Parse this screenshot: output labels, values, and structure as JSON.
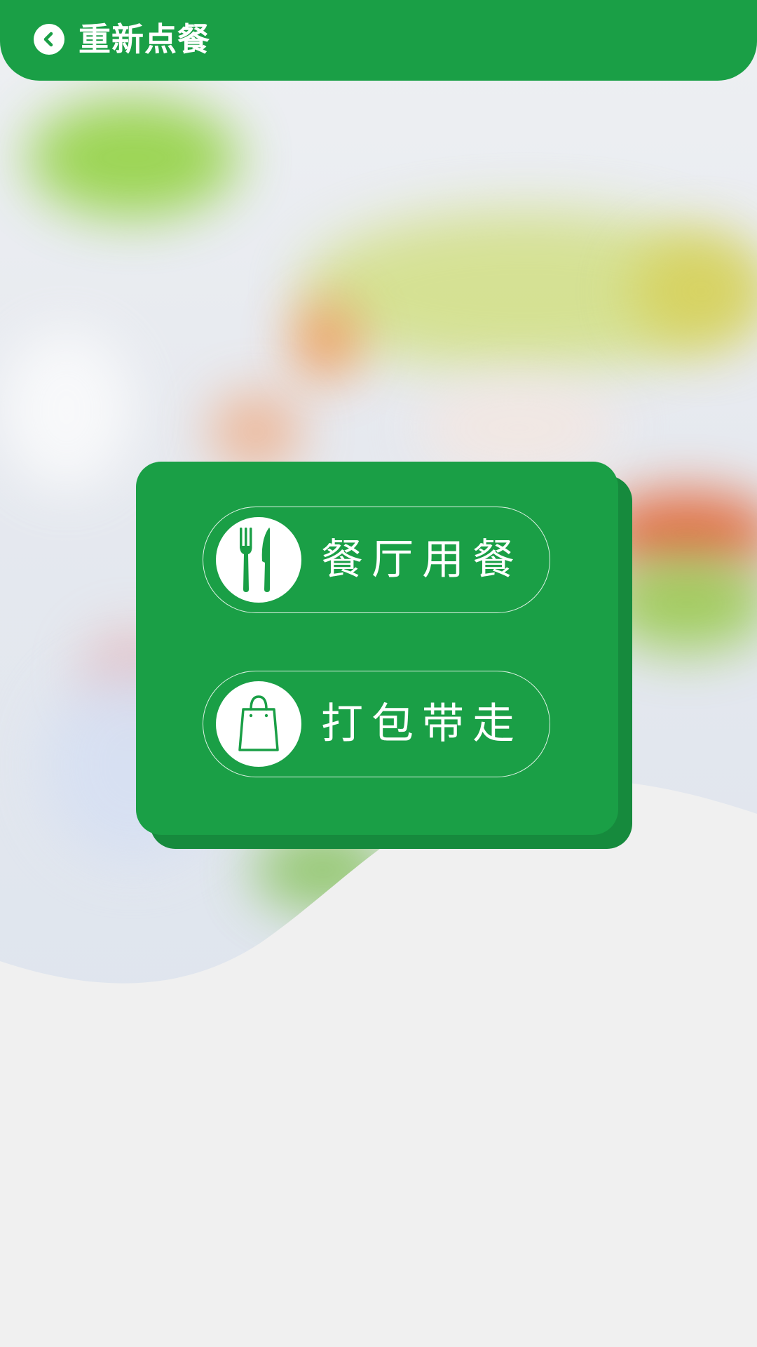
{
  "header": {
    "back_icon": "chevron-left-icon",
    "title": "重新点餐"
  },
  "options": {
    "dine_in": {
      "icon": "fork-knife-icon",
      "label": "餐厅用餐"
    },
    "takeaway": {
      "icon": "shopping-bag-icon",
      "label": "打包带走"
    }
  },
  "colors": {
    "brand_green": "#1a9f46",
    "shadow_green": "#168a3d",
    "background": "#efefef"
  }
}
